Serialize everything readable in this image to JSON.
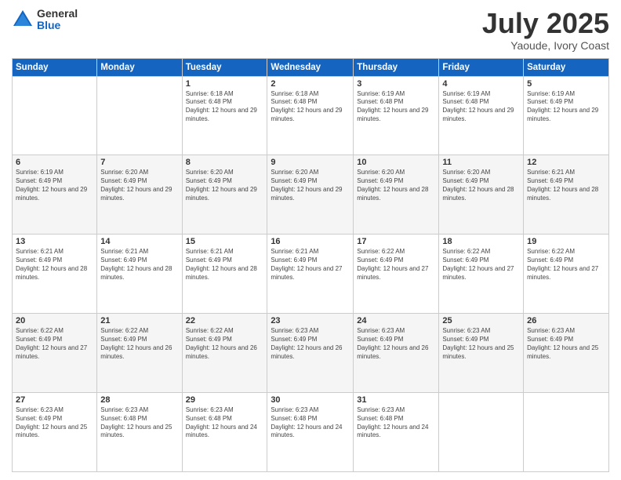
{
  "logo": {
    "general": "General",
    "blue": "Blue"
  },
  "title": "July 2025",
  "subtitle": "Yaoude, Ivory Coast",
  "days_of_week": [
    "Sunday",
    "Monday",
    "Tuesday",
    "Wednesday",
    "Thursday",
    "Friday",
    "Saturday"
  ],
  "weeks": [
    [
      {
        "day": "",
        "info": ""
      },
      {
        "day": "",
        "info": ""
      },
      {
        "day": "1",
        "info": "Sunrise: 6:18 AM\nSunset: 6:48 PM\nDaylight: 12 hours and 29 minutes."
      },
      {
        "day": "2",
        "info": "Sunrise: 6:18 AM\nSunset: 6:48 PM\nDaylight: 12 hours and 29 minutes."
      },
      {
        "day": "3",
        "info": "Sunrise: 6:19 AM\nSunset: 6:48 PM\nDaylight: 12 hours and 29 minutes."
      },
      {
        "day": "4",
        "info": "Sunrise: 6:19 AM\nSunset: 6:48 PM\nDaylight: 12 hours and 29 minutes."
      },
      {
        "day": "5",
        "info": "Sunrise: 6:19 AM\nSunset: 6:49 PM\nDaylight: 12 hours and 29 minutes."
      }
    ],
    [
      {
        "day": "6",
        "info": "Sunrise: 6:19 AM\nSunset: 6:49 PM\nDaylight: 12 hours and 29 minutes."
      },
      {
        "day": "7",
        "info": "Sunrise: 6:20 AM\nSunset: 6:49 PM\nDaylight: 12 hours and 29 minutes."
      },
      {
        "day": "8",
        "info": "Sunrise: 6:20 AM\nSunset: 6:49 PM\nDaylight: 12 hours and 29 minutes."
      },
      {
        "day": "9",
        "info": "Sunrise: 6:20 AM\nSunset: 6:49 PM\nDaylight: 12 hours and 29 minutes."
      },
      {
        "day": "10",
        "info": "Sunrise: 6:20 AM\nSunset: 6:49 PM\nDaylight: 12 hours and 28 minutes."
      },
      {
        "day": "11",
        "info": "Sunrise: 6:20 AM\nSunset: 6:49 PM\nDaylight: 12 hours and 28 minutes."
      },
      {
        "day": "12",
        "info": "Sunrise: 6:21 AM\nSunset: 6:49 PM\nDaylight: 12 hours and 28 minutes."
      }
    ],
    [
      {
        "day": "13",
        "info": "Sunrise: 6:21 AM\nSunset: 6:49 PM\nDaylight: 12 hours and 28 minutes."
      },
      {
        "day": "14",
        "info": "Sunrise: 6:21 AM\nSunset: 6:49 PM\nDaylight: 12 hours and 28 minutes."
      },
      {
        "day": "15",
        "info": "Sunrise: 6:21 AM\nSunset: 6:49 PM\nDaylight: 12 hours and 28 minutes."
      },
      {
        "day": "16",
        "info": "Sunrise: 6:21 AM\nSunset: 6:49 PM\nDaylight: 12 hours and 27 minutes."
      },
      {
        "day": "17",
        "info": "Sunrise: 6:22 AM\nSunset: 6:49 PM\nDaylight: 12 hours and 27 minutes."
      },
      {
        "day": "18",
        "info": "Sunrise: 6:22 AM\nSunset: 6:49 PM\nDaylight: 12 hours and 27 minutes."
      },
      {
        "day": "19",
        "info": "Sunrise: 6:22 AM\nSunset: 6:49 PM\nDaylight: 12 hours and 27 minutes."
      }
    ],
    [
      {
        "day": "20",
        "info": "Sunrise: 6:22 AM\nSunset: 6:49 PM\nDaylight: 12 hours and 27 minutes."
      },
      {
        "day": "21",
        "info": "Sunrise: 6:22 AM\nSunset: 6:49 PM\nDaylight: 12 hours and 26 minutes."
      },
      {
        "day": "22",
        "info": "Sunrise: 6:22 AM\nSunset: 6:49 PM\nDaylight: 12 hours and 26 minutes."
      },
      {
        "day": "23",
        "info": "Sunrise: 6:23 AM\nSunset: 6:49 PM\nDaylight: 12 hours and 26 minutes."
      },
      {
        "day": "24",
        "info": "Sunrise: 6:23 AM\nSunset: 6:49 PM\nDaylight: 12 hours and 26 minutes."
      },
      {
        "day": "25",
        "info": "Sunrise: 6:23 AM\nSunset: 6:49 PM\nDaylight: 12 hours and 25 minutes."
      },
      {
        "day": "26",
        "info": "Sunrise: 6:23 AM\nSunset: 6:49 PM\nDaylight: 12 hours and 25 minutes."
      }
    ],
    [
      {
        "day": "27",
        "info": "Sunrise: 6:23 AM\nSunset: 6:49 PM\nDaylight: 12 hours and 25 minutes."
      },
      {
        "day": "28",
        "info": "Sunrise: 6:23 AM\nSunset: 6:48 PM\nDaylight: 12 hours and 25 minutes."
      },
      {
        "day": "29",
        "info": "Sunrise: 6:23 AM\nSunset: 6:48 PM\nDaylight: 12 hours and 24 minutes."
      },
      {
        "day": "30",
        "info": "Sunrise: 6:23 AM\nSunset: 6:48 PM\nDaylight: 12 hours and 24 minutes."
      },
      {
        "day": "31",
        "info": "Sunrise: 6:23 AM\nSunset: 6:48 PM\nDaylight: 12 hours and 24 minutes."
      },
      {
        "day": "",
        "info": ""
      },
      {
        "day": "",
        "info": ""
      }
    ]
  ]
}
